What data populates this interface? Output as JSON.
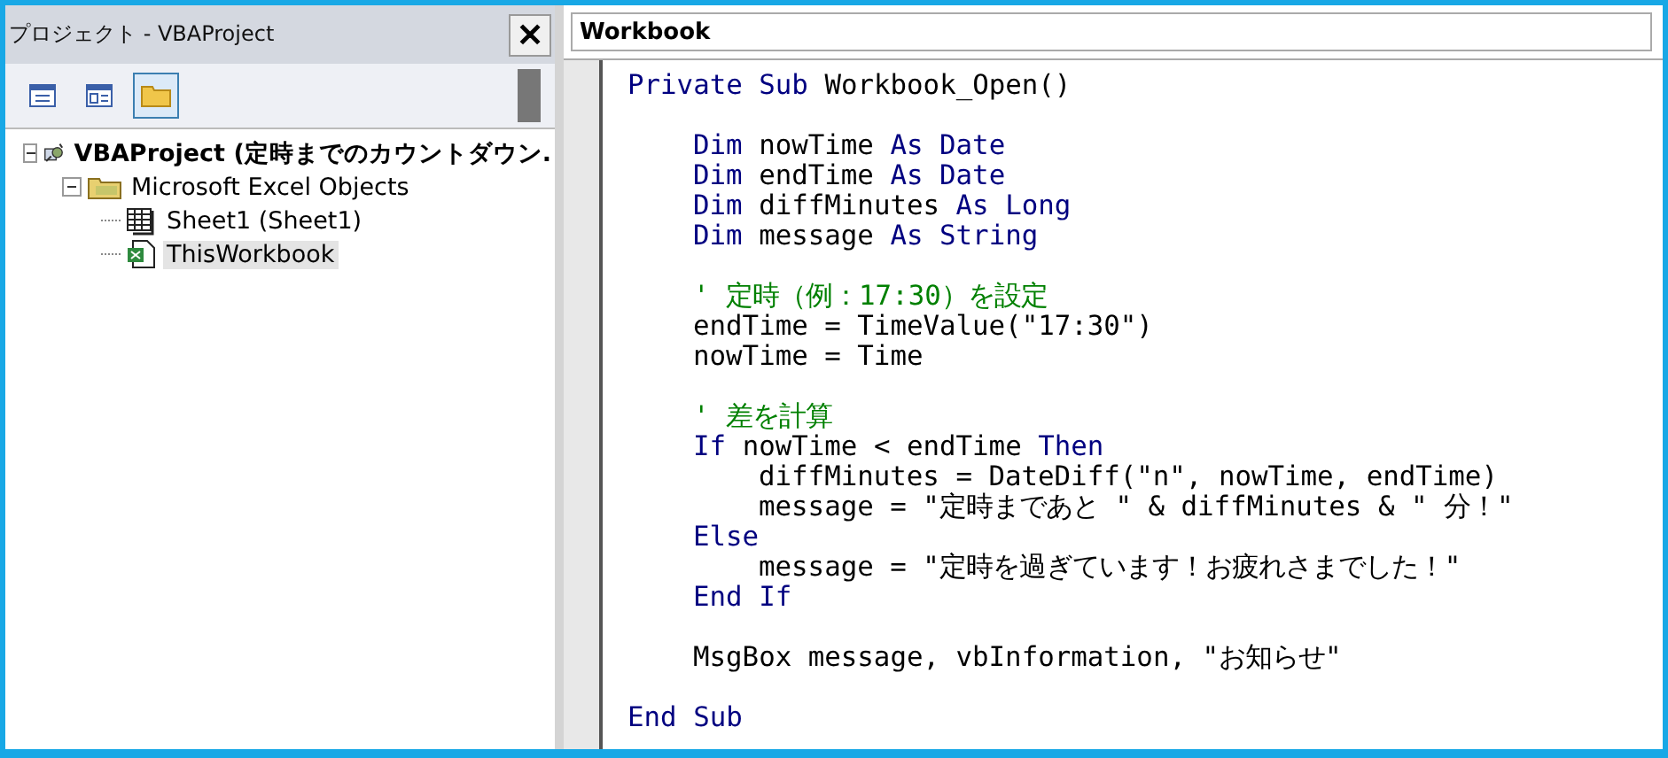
{
  "project_panel": {
    "title": "プロジェクト - VBAProject",
    "close": "✕",
    "toolbar": [
      {
        "kind": "view_code",
        "selected": false
      },
      {
        "kind": "view_object",
        "selected": false
      },
      {
        "kind": "toggle_folders",
        "selected": true
      }
    ],
    "tree": [
      {
        "kind": "project",
        "label": "VBAProject (定時までのカウントダウン.",
        "expanded": true,
        "selected": false,
        "children": [
          {
            "kind": "folder",
            "label": "Microsoft Excel Objects",
            "expanded": true,
            "selected": false,
            "children": [
              {
                "kind": "sheet",
                "label": "Sheet1 (Sheet1)",
                "selected": false
              },
              {
                "kind": "workbook",
                "label": "ThisWorkbook",
                "selected": true
              }
            ]
          }
        ]
      }
    ]
  },
  "code_window": {
    "object_box": "Workbook",
    "lines": [
      {
        "segments": [
          {
            "kind": "keyword",
            "text": "Private Sub "
          },
          {
            "kind": "plain",
            "text": "Workbook_Open()"
          }
        ],
        "children": [
          {
            "segments": [
              {
                "kind": "keyword",
                "text": "Dim "
              },
              {
                "kind": "plain",
                "text": "nowTime "
              },
              {
                "kind": "keyword",
                "text": "As Date"
              }
            ],
            "gap_before": true
          },
          {
            "segments": [
              {
                "kind": "keyword",
                "text": "Dim "
              },
              {
                "kind": "plain",
                "text": "endTime "
              },
              {
                "kind": "keyword",
                "text": "As Date"
              }
            ]
          },
          {
            "segments": [
              {
                "kind": "keyword",
                "text": "Dim "
              },
              {
                "kind": "plain",
                "text": "diffMinutes "
              },
              {
                "kind": "keyword",
                "text": "As Long"
              }
            ]
          },
          {
            "segments": [
              {
                "kind": "keyword",
                "text": "Dim "
              },
              {
                "kind": "plain",
                "text": "message "
              },
              {
                "kind": "keyword",
                "text": "As String"
              }
            ]
          },
          {
            "segments": [
              {
                "kind": "comment",
                "text": "' 定時（例：17:30）を設定"
              }
            ],
            "gap_before": true
          },
          {
            "segments": [
              {
                "kind": "plain",
                "text": "endTime = TimeValue(\"17:30\")"
              }
            ]
          },
          {
            "segments": [
              {
                "kind": "plain",
                "text": "nowTime = Time"
              }
            ]
          },
          {
            "segments": [
              {
                "kind": "comment",
                "text": "' 差を計算"
              }
            ],
            "gap_before": true
          },
          {
            "segments": [
              {
                "kind": "keyword",
                "text": "If "
              },
              {
                "kind": "plain",
                "text": "nowTime < endTime "
              },
              {
                "kind": "keyword",
                "text": "Then"
              }
            ],
            "children": [
              {
                "segments": [
                  {
                    "kind": "plain",
                    "text": "diffMinutes = DateDiff(\"n\", nowTime, endTime)"
                  }
                ]
              },
              {
                "segments": [
                  {
                    "kind": "plain",
                    "text": "message = \"定時まであと \" & diffMinutes & \" 分！\""
                  }
                ]
              }
            ]
          },
          {
            "segments": [
              {
                "kind": "keyword",
                "text": "Else"
              }
            ],
            "children": [
              {
                "segments": [
                  {
                    "kind": "plain",
                    "text": "message = \"定時を過ぎています！お疲れさまでした！\""
                  }
                ]
              }
            ]
          },
          {
            "segments": [
              {
                "kind": "keyword",
                "text": "End If"
              }
            ]
          },
          {
            "segments": [
              {
                "kind": "plain",
                "text": "MsgBox message, vbInformation, \"お知らせ\""
              }
            ],
            "gap_before": true
          }
        ]
      },
      {
        "segments": [
          {
            "kind": "keyword",
            "text": "End Sub"
          }
        ],
        "gap_before": true
      }
    ]
  }
}
